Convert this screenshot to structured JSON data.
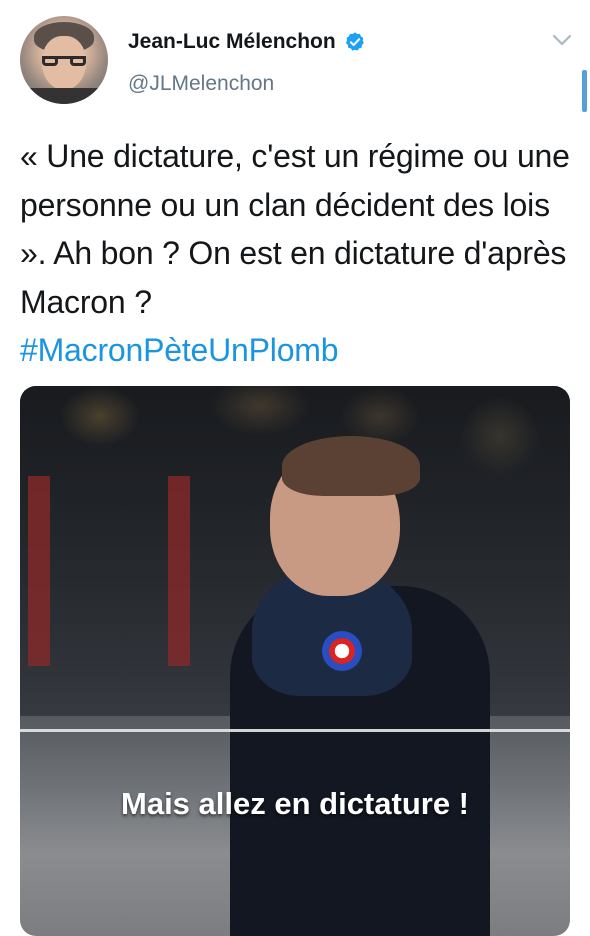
{
  "author": {
    "display_name": "Jean-Luc Mélenchon",
    "handle": "@JLMelenchon",
    "verified": true
  },
  "icons": {
    "verified": "verified-badge-icon",
    "menu": "chevron-down-icon"
  },
  "tweet": {
    "text": "« Une dictature, c'est un régime ou une personne ou un clan décident des lois ». Ah bon ? On est en dictature d'après Macron ?",
    "hashtag": "#MacronPèteUnPlomb"
  },
  "media": {
    "caption": "Mais allez en dictature !"
  },
  "colors": {
    "link": "#1b95e0",
    "verified": "#1da1f2",
    "secondary_text": "#657786",
    "primary_text": "#14171a"
  }
}
